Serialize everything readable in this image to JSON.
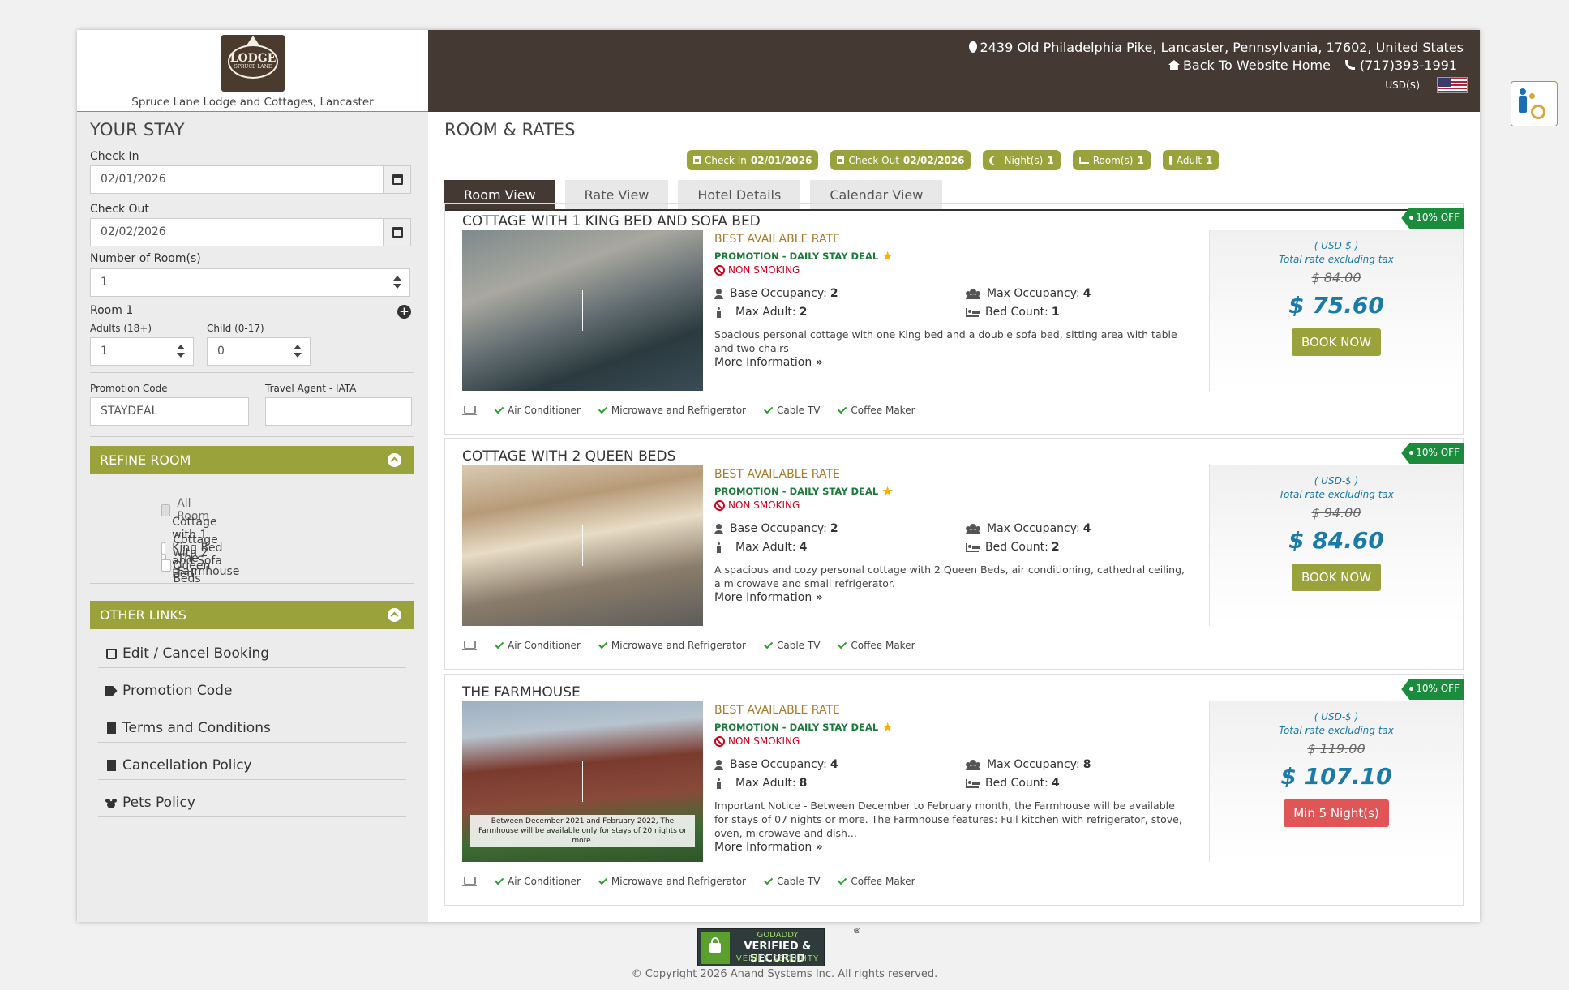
{
  "header": {
    "logo_text": "SPRUCE LANE LODGE & COTTAGES",
    "hotel_name": "Spruce Lane Lodge and Cottages, Lancaster",
    "address": "2439 Old Philadelphia Pike, Lancaster, Pennsylvania, 17602, United States",
    "back_home": "Back To Website Home",
    "phone": "(717)393-1991",
    "currency": "USD($)"
  },
  "sidebar": {
    "title": "YOUR STAY",
    "check_in_label": "Check In",
    "check_in_value": "02/01/2026",
    "check_out_label": "Check Out",
    "check_out_value": "02/02/2026",
    "rooms_label": "Number of Room(s)",
    "rooms_value": "1",
    "room1_label": "Room 1",
    "adults_label": "Adults (18+)",
    "adults_value": "1",
    "child_label": "Child (0-17)",
    "child_value": "0",
    "promo_label": "Promotion Code",
    "promo_value": "STAYDEAL",
    "agent_label": "Travel Agent - IATA",
    "agent_value": "",
    "refine_title": "REFINE ROOM",
    "refine_items": [
      "All Room",
      "Cottage with 1 King Bed and Sofa Bed",
      "Cottage with 2 Queen Beds",
      "The Farmhouse"
    ],
    "links_title": "OTHER LINKS",
    "links": [
      "Edit / Cancel Booking",
      "Promotion Code",
      "Terms and Conditions",
      "Cancellation Policy",
      "Pets Policy"
    ]
  },
  "main": {
    "title": "ROOM & RATES",
    "pills": [
      {
        "label": "Check In",
        "value": "02/01/2026"
      },
      {
        "label": "Check Out",
        "value": "02/02/2026"
      },
      {
        "label": "Night(s)",
        "value": "1"
      },
      {
        "label": "Room(s)",
        "value": "1"
      },
      {
        "label": "Adult",
        "value": "1"
      }
    ],
    "tabs": [
      "Room View",
      "Rate View",
      "Hotel Details",
      "Calendar View"
    ],
    "rooms": [
      {
        "name": "COTTAGE WITH 1 KING BED AND SOFA BED",
        "badge": "10% OFF",
        "rate": "BEST AVAILABLE RATE",
        "promo": "PROMOTION - DAILY STAY DEAL",
        "smoking": "NON SMOKING",
        "base_occ_label": "Base Occupancy:",
        "base_occ": "2",
        "max_occ_label": "Max Occupancy:",
        "max_occ": "4",
        "max_adult_label": "Max Adult:",
        "max_adult": "2",
        "bed_count_label": "Bed Count:",
        "bed_count": "1",
        "description": "Spacious personal cottage with one King bed and a double sofa bed, sitting area with table and two chairs",
        "more": "More Information",
        "currency": "( USD-$ )",
        "tax_note": "Total rate excluding tax",
        "old_price": "$ 84.00",
        "price": "$ 75.60",
        "button": "BOOK NOW",
        "photo_caption": ""
      },
      {
        "name": "COTTAGE WITH 2 QUEEN BEDS",
        "badge": "10% OFF",
        "rate": "BEST AVAILABLE RATE",
        "promo": "PROMOTION - DAILY STAY DEAL",
        "smoking": "NON SMOKING",
        "base_occ_label": "Base Occupancy:",
        "base_occ": "2",
        "max_occ_label": "Max Occupancy:",
        "max_occ": "4",
        "max_adult_label": "Max Adult:",
        "max_adult": "4",
        "bed_count_label": "Bed Count:",
        "bed_count": "2",
        "description": "A spacious and cozy personal cottage with 2 Queen Beds, air conditioning, cathedral ceiling, a microwave and small refrigerator.",
        "more": "More Information",
        "currency": "( USD-$ )",
        "tax_note": "Total rate excluding tax",
        "old_price": "$ 94.00",
        "price": "$ 84.60",
        "button": "BOOK NOW",
        "photo_caption": ""
      },
      {
        "name": "THE FARMHOUSE",
        "badge": "10% OFF",
        "rate": "BEST AVAILABLE RATE",
        "promo": "PROMOTION - DAILY STAY DEAL",
        "smoking": "NON SMOKING",
        "base_occ_label": "Base Occupancy:",
        "base_occ": "4",
        "max_occ_label": "Max Occupancy:",
        "max_occ": "8",
        "max_adult_label": "Max Adult:",
        "max_adult": "8",
        "bed_count_label": "Bed Count:",
        "bed_count": "4",
        "description": "Important Notice - Between December to February month, the Farmhouse will be available for stays of 07 nights or more. The Farmhouse features: Full kitchen with refrigerator, stove, oven, microwave and dish...",
        "more": "More Information",
        "currency": "( USD-$ )",
        "tax_note": "Total rate excluding tax",
        "old_price": "$ 119.00",
        "price": "$ 107.10",
        "button": "Min 5 Night(s)",
        "photo_caption": "Between December 2021 and February 2022, The Farmhouse will be available only for stays of 20 nights or more."
      }
    ],
    "amenities": [
      "Air Conditioner",
      "Microwave and Refrigerator",
      "Cable TV",
      "Coffee Maker"
    ]
  },
  "footer": {
    "seal_top": "GODADDY",
    "seal_main": "VERIFIED & SECURED",
    "seal_bottom": "VERIFY SECURITY",
    "seal_reg": "®",
    "copyright": "© Copyright 2026 Anand Systems Inc. All rights reserved."
  },
  "colors": {
    "accent_olive": "#9aa23c",
    "header_brown": "#443a33",
    "price_blue": "#1a7aa8",
    "discount_green": "#1b8c3c",
    "min_night_red": "#e05555"
  }
}
